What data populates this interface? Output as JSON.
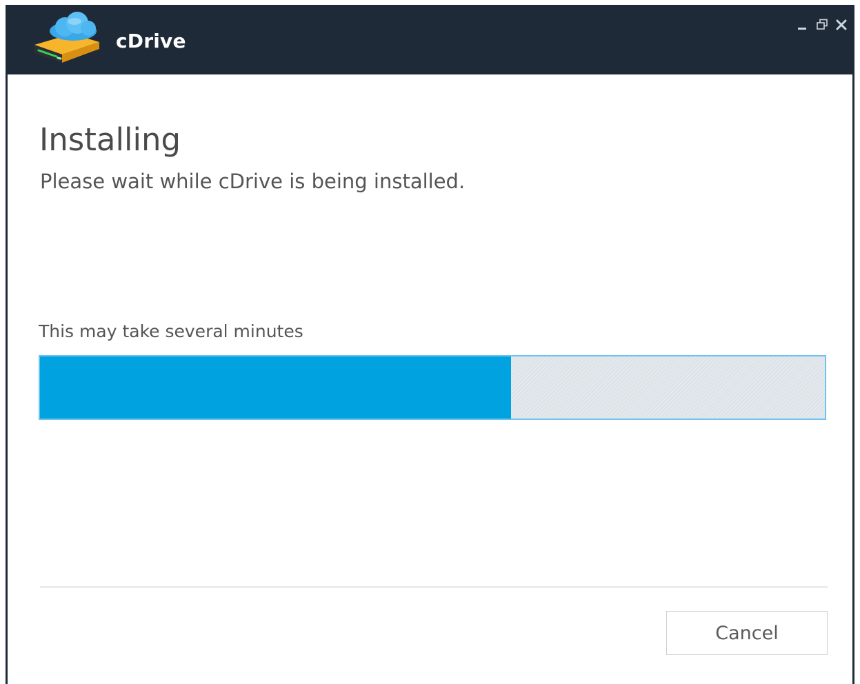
{
  "window": {
    "app_name": "cDrive",
    "logo_icon": "cloud-drive-icon",
    "controls": {
      "minimize_icon": "minimize-icon",
      "restore_icon": "restore-icon",
      "close_icon": "close-icon"
    }
  },
  "main": {
    "title": "Installing",
    "subtitle": "Please wait while cDrive is being installed.",
    "hint": "This may take several minutes",
    "progress_fraction": 0.6
  },
  "footer": {
    "cancel_label": "Cancel"
  },
  "colors": {
    "titlebar": "#1f2a38",
    "accent": "#00a2e0",
    "progress_track": "#dde3e8"
  }
}
